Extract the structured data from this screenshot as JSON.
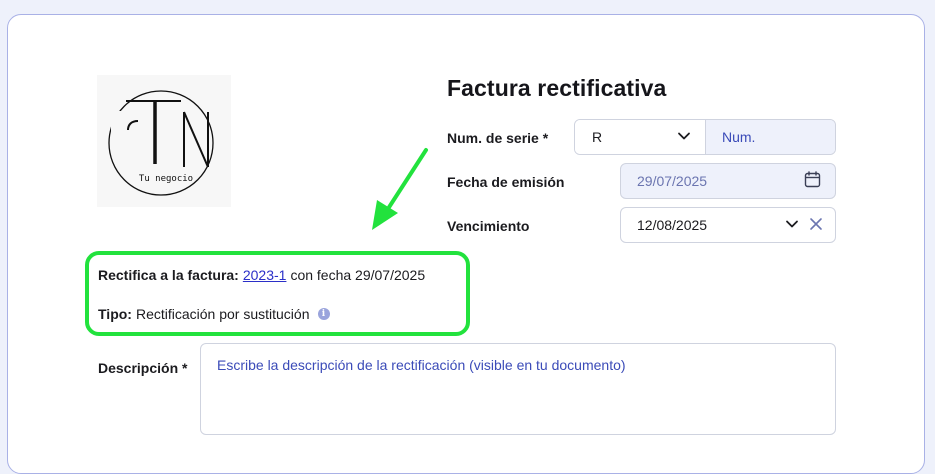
{
  "logo": {
    "letters": "TN",
    "tagline": "Tu negocio"
  },
  "title": "Factura rectificativa",
  "serie": {
    "label": "Num. de serie *",
    "selected": "R",
    "num_placeholder": "Num."
  },
  "emision": {
    "label": "Fecha de emisión",
    "value": "29/07/2025"
  },
  "vencimiento": {
    "label": "Vencimiento",
    "value": "12/08/2025"
  },
  "rectifica": {
    "label": "Rectifica a la factura:",
    "invoice_link": "2023-1",
    "suffix": "con fecha 29/07/2025"
  },
  "tipo": {
    "label": "Tipo:",
    "value": "Rectificación por sustitución"
  },
  "descripcion": {
    "label": "Descripción *",
    "placeholder": "Escribe la descripción de la rectificación (visible en tu documento)"
  },
  "colors": {
    "highlight": "#22e23d",
    "link": "#2b2fc8",
    "card_border": "#a9b1e6",
    "disabled_bg": "#eef1fb"
  }
}
